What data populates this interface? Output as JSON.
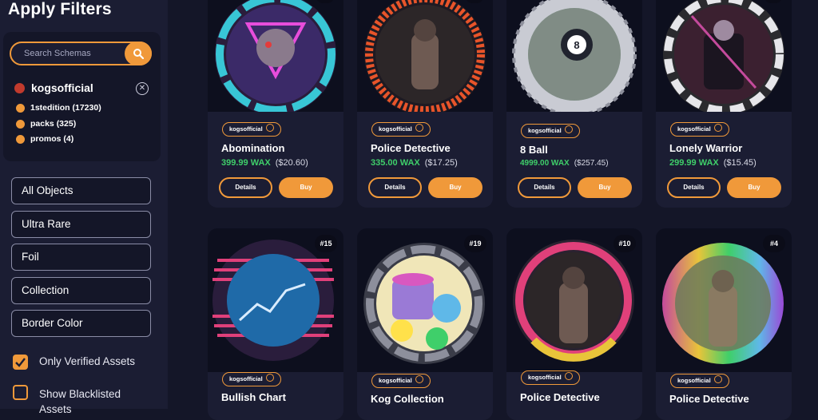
{
  "sidebar": {
    "title": "Apply Filters",
    "search": {
      "placeholder": "Search Schemas",
      "value": ""
    },
    "collection": {
      "name": "kogsofficial",
      "schemas": [
        {
          "label": "1stedition (17230)"
        },
        {
          "label": "packs (325)"
        },
        {
          "label": "promos (4)"
        }
      ]
    },
    "filters": [
      "All Objects",
      "Ultra Rare",
      "Foil",
      "Collection",
      "Border Color"
    ],
    "checkboxes": [
      {
        "label": "Only Verified Assets",
        "checked": true
      },
      {
        "label": "Show Blacklisted Assets",
        "checked": false
      }
    ]
  },
  "accent_color": "#f0993a",
  "price_color": "#3fcf6a",
  "cards": [
    {
      "name": "Abomination",
      "owner": "kogsofficial",
      "wax": "399.99 WAX",
      "usd": "($20.60)",
      "details": "Details",
      "buy": "Buy",
      "badge": ""
    },
    {
      "name": "Police Detective",
      "owner": "kogsofficial",
      "wax": "335.00 WAX",
      "usd": "($17.25)",
      "details": "Details",
      "buy": "Buy",
      "badge": ""
    },
    {
      "name": "8 Ball",
      "owner": "kogsofficial",
      "wax": "4999.00 WAX",
      "usd": "($257.45)",
      "details": "Details",
      "buy": "Buy",
      "badge": ""
    },
    {
      "name": "Lonely Warrior",
      "owner": "kogsofficial",
      "wax": "299.99 WAX",
      "usd": "($15.45)",
      "details": "Details",
      "buy": "Buy",
      "badge": ""
    },
    {
      "name": "Bullish Chart",
      "owner": "kogsofficial",
      "badge": "#15"
    },
    {
      "name": "Kog Collection",
      "owner": "kogsofficial",
      "badge": "#19"
    },
    {
      "name": "Police Detective",
      "owner": "kogsofficial",
      "badge": "#10"
    },
    {
      "name": "Police Detective",
      "owner": "kogsofficial",
      "badge": "#4"
    }
  ]
}
